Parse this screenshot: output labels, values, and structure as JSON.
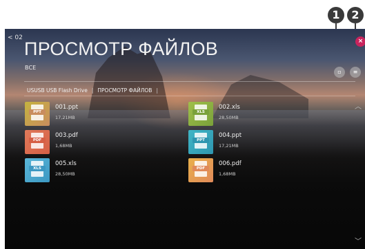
{
  "callouts": [
    "1",
    "2"
  ],
  "header": {
    "back_label": "< 02",
    "title": "ПРОСМОТР ФАЙЛОВ",
    "filter_label": "ВСЕ",
    "close_icon": "×",
    "view_icon": "▫",
    "options_icon": "≡"
  },
  "breadcrumb": {
    "device": "USUSB  USB Flash Drive",
    "current": "ПРОСМОТР ФАЙЛОВ",
    "separator": "|"
  },
  "scroll": {
    "up": "︿",
    "down": "﹀"
  },
  "files": [
    {
      "name": "001.ppt",
      "size": "17,21MB",
      "type": "PPT",
      "thumb_color": "#c5b33f",
      "tag_color": "#c98d5e"
    },
    {
      "name": "002.xls",
      "size": "28,50MB",
      "type": "XLS",
      "thumb_color": "#9fbf4a",
      "tag_color": "#7aa13a"
    },
    {
      "name": "003.pdf",
      "size": "1,68MB",
      "type": "PDF",
      "thumb_color": "#e07a5a",
      "tag_color": "#d65f45"
    },
    {
      "name": "004.ppt",
      "size": "17,21MB",
      "type": "PPT",
      "thumb_color": "#3fb6c6",
      "tag_color": "#2f96b0"
    },
    {
      "name": "005.xls",
      "size": "28,50MB",
      "type": "XLS",
      "thumb_color": "#5ab6d8",
      "tag_color": "#3c98c2"
    },
    {
      "name": "006.pdf",
      "size": "1,68MB",
      "type": "PDF",
      "thumb_color": "#e9b04a",
      "tag_color": "#e08a5a"
    }
  ]
}
